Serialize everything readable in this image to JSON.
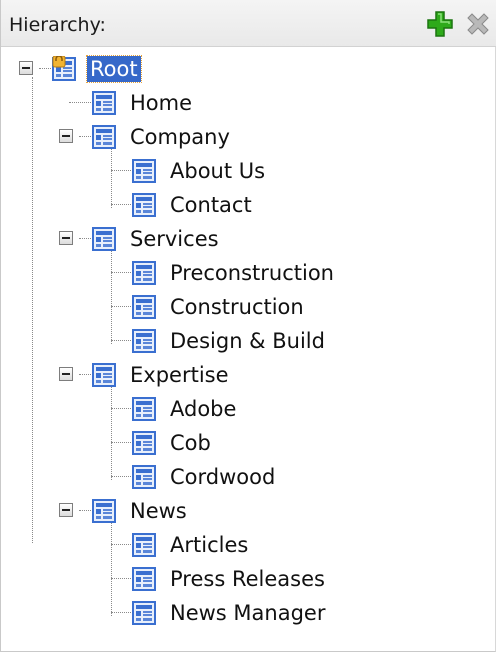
{
  "header": {
    "title": "Hierarchy:"
  },
  "icons": {
    "add": "green-plus-icon",
    "delete": "gray-x-icon",
    "page": "page-icon",
    "locked_page": "locked-page-icon"
  },
  "colors": {
    "selection": "#3668c9",
    "add_green": "#2eaa1a",
    "icon_blue": "#3a6fd0"
  },
  "tree": {
    "root": {
      "label": "Root",
      "selected": true
    },
    "home": {
      "label": "Home"
    },
    "company": {
      "label": "Company",
      "children": [
        "About Us",
        "Contact"
      ]
    },
    "about_us": {
      "label": "About Us"
    },
    "contact": {
      "label": "Contact"
    },
    "services": {
      "label": "Services"
    },
    "preconstruction": {
      "label": "Preconstruction"
    },
    "construction": {
      "label": "Construction"
    },
    "design_build": {
      "label": "Design & Build"
    },
    "expertise": {
      "label": "Expertise"
    },
    "adobe": {
      "label": "Adobe"
    },
    "cob": {
      "label": "Cob"
    },
    "cordwood": {
      "label": "Cordwood"
    },
    "news": {
      "label": "News"
    },
    "articles": {
      "label": "Articles"
    },
    "press_releases": {
      "label": "Press Releases"
    },
    "news_manager": {
      "label": "News Manager"
    }
  }
}
